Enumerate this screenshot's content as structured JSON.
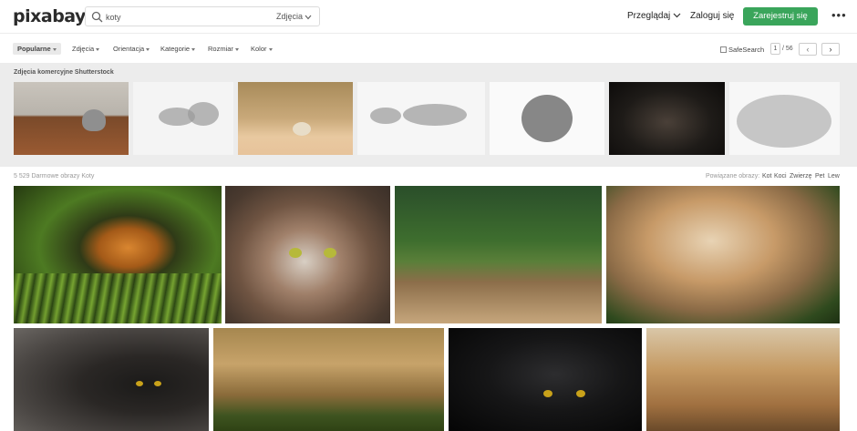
{
  "header": {
    "logo": "pixabay",
    "search_value": "koty",
    "search_type": "Zdjęcia",
    "browse": "Przeglądaj",
    "login": "Zaloguj się",
    "register": "Zarejestruj się",
    "more": "•••"
  },
  "filters": {
    "popular": "Popularne",
    "items": [
      "Zdjęcia",
      "Orientacja",
      "Kategorie",
      "Rozmiar",
      "Kolor"
    ],
    "safesearch": "SafeSearch",
    "page_current": "1",
    "page_total": "/ 56",
    "prev": "‹",
    "next": "›"
  },
  "shutterstock": {
    "title": "Zdjęcia komercyjne Shutterstock"
  },
  "results": {
    "count": "5 529 Darmowe obrazy Koty",
    "related_label": "Powiązane obrazy:",
    "related_tags": [
      "Kot",
      "Koci",
      "Zwierzę",
      "Pet",
      "Lew"
    ]
  },
  "colors": {
    "accent_green": "#3aa55b",
    "strip_bg": "#ececec"
  },
  "icons": {
    "search": "search-icon",
    "chevron": "chevron-down-icon",
    "more": "more-icon"
  }
}
